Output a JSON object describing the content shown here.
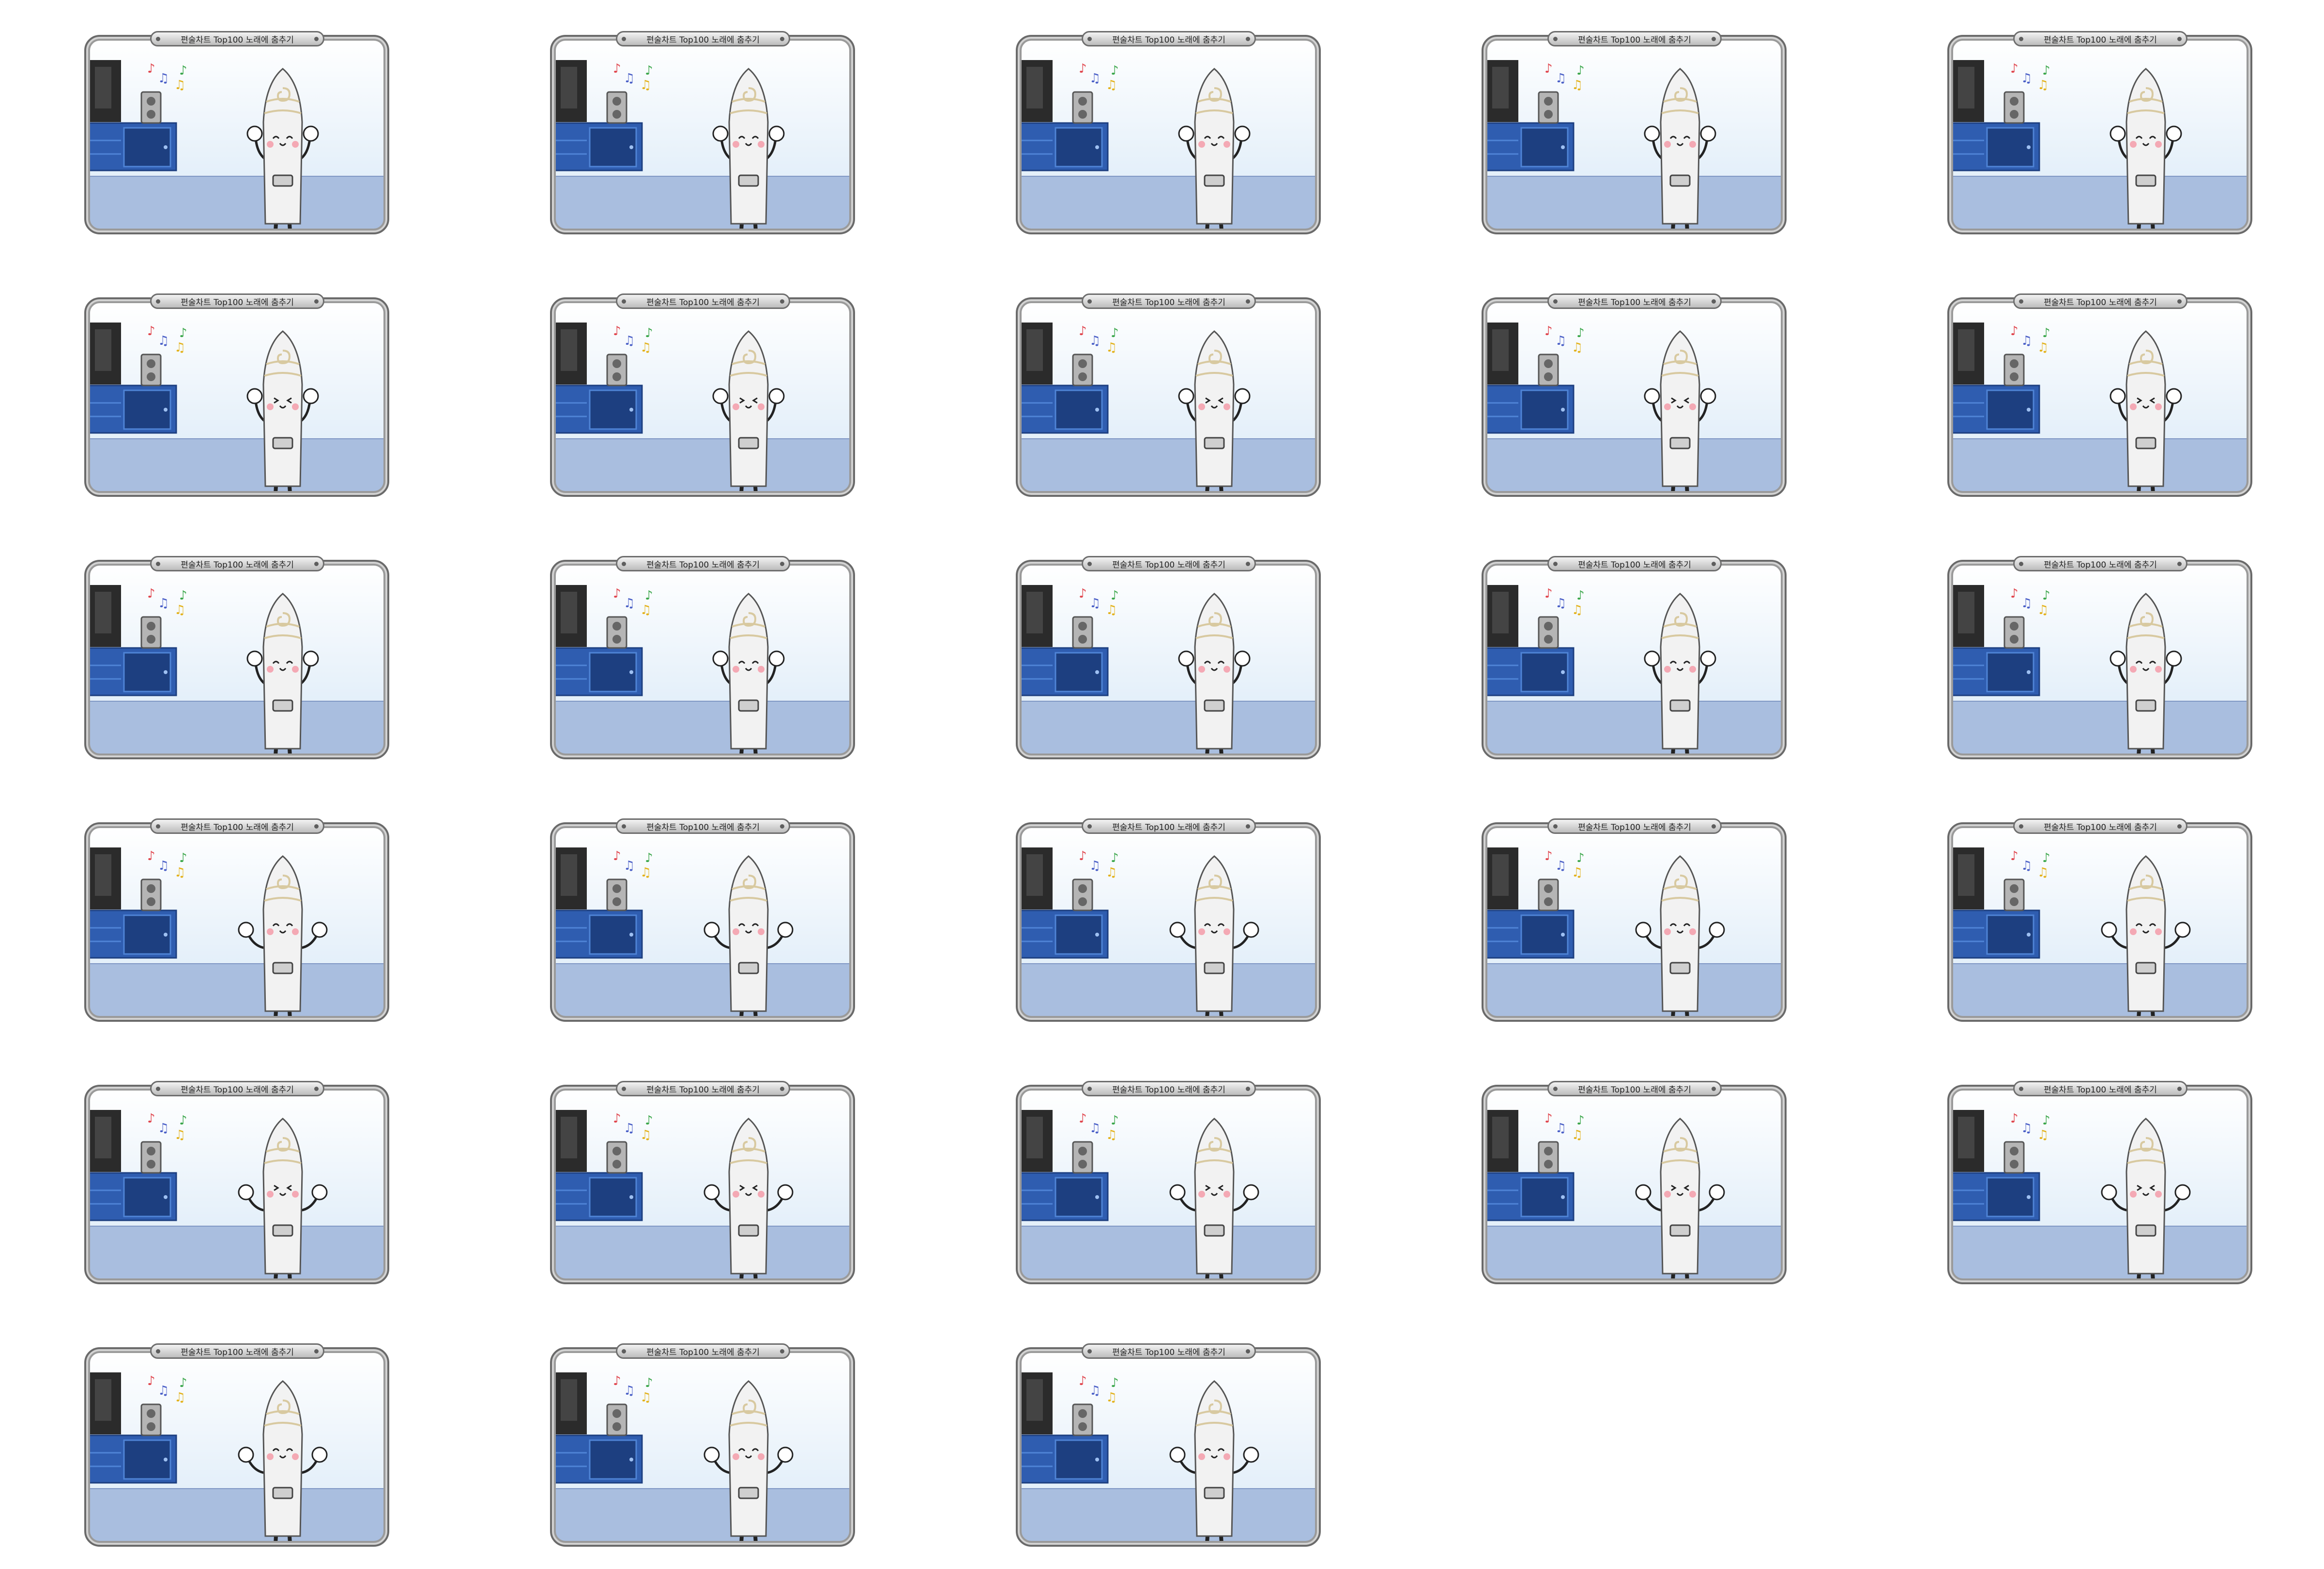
{
  "banner_text": "편술차트 Top100 노래에 춤추기",
  "frames": [
    {
      "label": "편술차트 Top100 노래에 춤추기",
      "pose": "arms-up"
    },
    {
      "label": "편술차트 Top100 노래에 춤추기",
      "pose": "arms-up"
    },
    {
      "label": "편술차트 Top100 노래에 춤추기",
      "pose": "arms-up"
    },
    {
      "label": "편술차트 Top100 노래에 춤추기",
      "pose": "arms-up"
    },
    {
      "label": "편술차트 Top100 노래에 춤추기",
      "pose": "arms-up"
    },
    {
      "label": "편술차트 Top100 노래에 춤추기",
      "pose": "arms-up-squint"
    },
    {
      "label": "편술차트 Top100 노래에 춤추기",
      "pose": "arms-up-squint"
    },
    {
      "label": "편술차트 Top100 노래에 춤추기",
      "pose": "arms-up-squint"
    },
    {
      "label": "편술차트 Top100 노래에 춤추기",
      "pose": "arms-up-squint"
    },
    {
      "label": "편술차트 Top100 노래에 춤추기",
      "pose": "arms-up-squint"
    },
    {
      "label": "편술차트 Top100 노래에 춤추기",
      "pose": "arms-up"
    },
    {
      "label": "편술차트 Top100 노래에 춤추기",
      "pose": "arms-up"
    },
    {
      "label": "편술차트 Top100 노래에 춤추기",
      "pose": "arms-up"
    },
    {
      "label": "편술차트 Top100 노래에 춤추기",
      "pose": "arms-up"
    },
    {
      "label": "편술차트 Top100 노래에 춤추기",
      "pose": "arms-up"
    },
    {
      "label": "편술차트 Top100 노래에 춤추기",
      "pose": "arms-wide"
    },
    {
      "label": "편술차트 Top100 노래에 춤추기",
      "pose": "arms-wide"
    },
    {
      "label": "편술차트 Top100 노래에 춤추기",
      "pose": "arms-wide"
    },
    {
      "label": "편술차트 Top100 노래에 춤추기",
      "pose": "arms-wide"
    },
    {
      "label": "편술차트 Top100 노래에 춤추기",
      "pose": "arms-wide"
    },
    {
      "label": "편술차트 Top100 노래에 춤추기",
      "pose": "arms-wide-squint"
    },
    {
      "label": "편술차트 Top100 노래에 춤추기",
      "pose": "arms-wide-squint"
    },
    {
      "label": "편술차트 Top100 노래에 춤추기",
      "pose": "arms-wide-squint"
    },
    {
      "label": "편술차트 Top100 노래에 춤추기",
      "pose": "arms-wide-squint"
    },
    {
      "label": "편술차트 Top100 노래에 춤추기",
      "pose": "arms-wide-squint"
    },
    {
      "label": "편술차트 Top100 노래에 춤추기",
      "pose": "arms-wide"
    },
    {
      "label": "편술차트 Top100 노래에 춤추기",
      "pose": "arms-wide"
    },
    {
      "label": "편술차트 Top100 노래에 춤추기",
      "pose": "arms-wide"
    }
  ],
  "colors": {
    "frame_border": "#8a8a8a",
    "wall_top": "#ffffff",
    "wall_bottom": "#d9e9f7",
    "floor": "#a9bedf",
    "cabinet": "#2f5db0",
    "cabinet_dark": "#1d3f80",
    "tv": "#2b2b2b",
    "speaker": "#b5b5b5",
    "character_body": "#f2f2f2",
    "cheek": "#f4a9b4",
    "note_red": "#e0454d",
    "note_blue": "#4a5fc7",
    "note_green": "#3aa64a",
    "note_yellow": "#e3b21c",
    "shadow": "#4b6aa8"
  }
}
